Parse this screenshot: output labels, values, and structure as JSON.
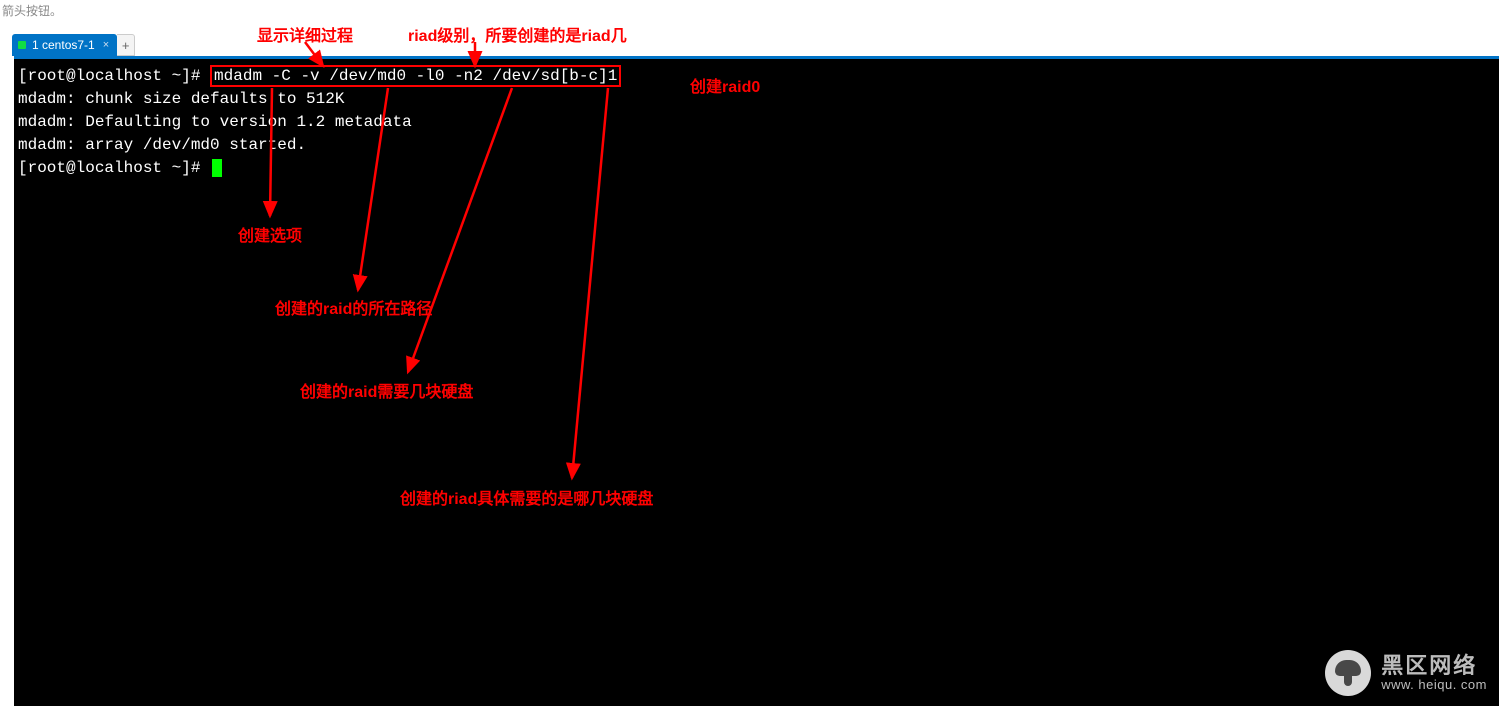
{
  "hint_text": "箭头按钮。",
  "tab": {
    "label": "1 centos7-1",
    "add": "+"
  },
  "top_annotations": {
    "verbose": "显示详细过程",
    "level": "riad级别，所要创建的是riad几"
  },
  "terminal": {
    "prompt1": "[root@localhost ~]# ",
    "command": "mdadm -C -v /dev/md0 -l0 -n2 /dev/sd[b-c]1",
    "out1": "mdadm: chunk size defaults to 512K",
    "out2": "mdadm: Defaulting to version 1.2 metadata",
    "out3": "mdadm: array /dev/md0 started.",
    "prompt2": "[root@localhost ~]# "
  },
  "annotations": {
    "create_raid0": "创建raid0",
    "create_option": "创建选项",
    "raid_path": "创建的raid的所在路径",
    "disk_count": "创建的raid需要几块硬盘",
    "which_disks": "创建的riad具体需要的是哪几块硬盘"
  },
  "watermark": {
    "title": "黑区网络",
    "url": "www. heiqu. com"
  }
}
